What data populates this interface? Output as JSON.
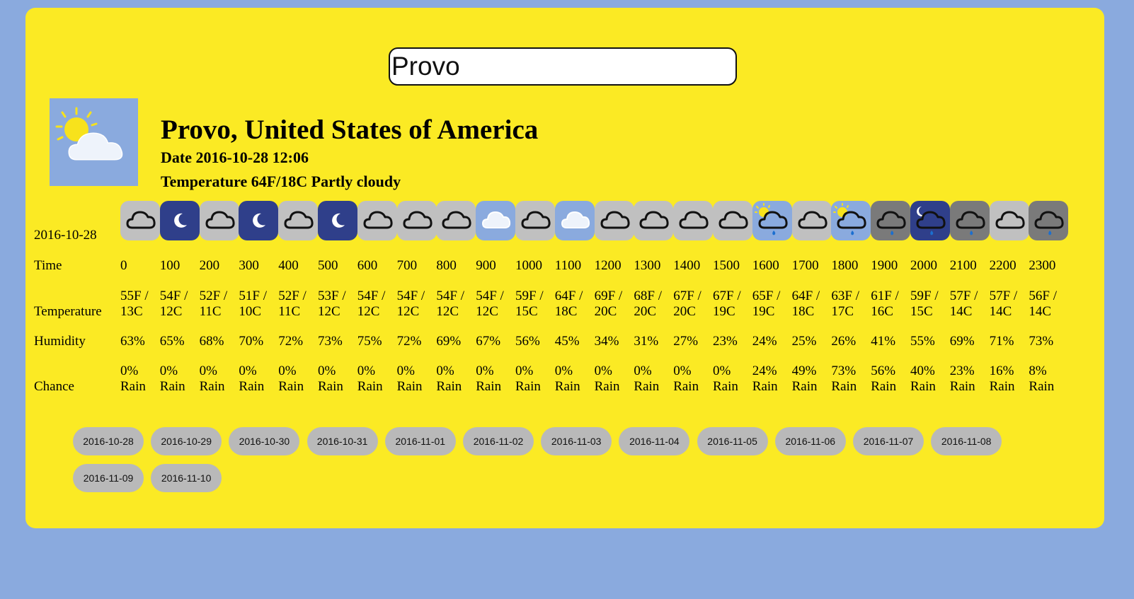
{
  "search": {
    "value": "Provo"
  },
  "current": {
    "location": "Provo, United States of America",
    "date": "Date 2016-10-28 12:06",
    "conditions": "Temperature 64F/18C Partly cloudy",
    "icon": "partly-cloudy-sun-icon"
  },
  "forecast": {
    "date": "2016-10-28",
    "labels": {
      "time": "Time",
      "temperature": "Temperature",
      "humidity": "Humidity",
      "chance": "Chance"
    },
    "hours": [
      {
        "time": "0",
        "temp_f": "55F /",
        "temp_c": "13C",
        "humidity": "63%",
        "rain_pct": "0%",
        "rain_word": "Rain",
        "icon": "cloud-outline-icon"
      },
      {
        "time": "100",
        "temp_f": "54F /",
        "temp_c": "12C",
        "humidity": "65%",
        "rain_pct": "0%",
        "rain_word": "Rain",
        "icon": "clear-night-moon-icon"
      },
      {
        "time": "200",
        "temp_f": "52F /",
        "temp_c": "11C",
        "humidity": "68%",
        "rain_pct": "0%",
        "rain_word": "Rain",
        "icon": "cloud-outline-icon"
      },
      {
        "time": "300",
        "temp_f": "51F /",
        "temp_c": "10C",
        "humidity": "70%",
        "rain_pct": "0%",
        "rain_word": "Rain",
        "icon": "clear-night-moon-icon"
      },
      {
        "time": "400",
        "temp_f": "52F /",
        "temp_c": "11C",
        "humidity": "72%",
        "rain_pct": "0%",
        "rain_word": "Rain",
        "icon": "cloud-outline-icon"
      },
      {
        "time": "500",
        "temp_f": "53F /",
        "temp_c": "12C",
        "humidity": "73%",
        "rain_pct": "0%",
        "rain_word": "Rain",
        "icon": "clear-night-moon-icon"
      },
      {
        "time": "600",
        "temp_f": "54F /",
        "temp_c": "12C",
        "humidity": "75%",
        "rain_pct": "0%",
        "rain_word": "Rain",
        "icon": "cloud-outline-icon"
      },
      {
        "time": "700",
        "temp_f": "54F /",
        "temp_c": "12C",
        "humidity": "72%",
        "rain_pct": "0%",
        "rain_word": "Rain",
        "icon": "cloud-outline-icon"
      },
      {
        "time": "800",
        "temp_f": "54F /",
        "temp_c": "12C",
        "humidity": "69%",
        "rain_pct": "0%",
        "rain_word": "Rain",
        "icon": "cloud-outline-icon"
      },
      {
        "time": "900",
        "temp_f": "54F /",
        "temp_c": "12C",
        "humidity": "67%",
        "rain_pct": "0%",
        "rain_word": "Rain",
        "icon": "white-cloud-icon"
      },
      {
        "time": "1000",
        "temp_f": "59F /",
        "temp_c": "15C",
        "humidity": "56%",
        "rain_pct": "0%",
        "rain_word": "Rain",
        "icon": "cloud-outline-icon"
      },
      {
        "time": "1100",
        "temp_f": "64F /",
        "temp_c": "18C",
        "humidity": "45%",
        "rain_pct": "0%",
        "rain_word": "Rain",
        "icon": "white-cloud-icon"
      },
      {
        "time": "1200",
        "temp_f": "69F /",
        "temp_c": "20C",
        "humidity": "34%",
        "rain_pct": "0%",
        "rain_word": "Rain",
        "icon": "cloud-outline-icon"
      },
      {
        "time": "1300",
        "temp_f": "68F /",
        "temp_c": "20C",
        "humidity": "31%",
        "rain_pct": "0%",
        "rain_word": "Rain",
        "icon": "cloud-outline-icon"
      },
      {
        "time": "1400",
        "temp_f": "67F /",
        "temp_c": "20C",
        "humidity": "27%",
        "rain_pct": "0%",
        "rain_word": "Rain",
        "icon": "cloud-outline-icon"
      },
      {
        "time": "1500",
        "temp_f": "67F /",
        "temp_c": "19C",
        "humidity": "23%",
        "rain_pct": "0%",
        "rain_word": "Rain",
        "icon": "cloud-outline-icon"
      },
      {
        "time": "1600",
        "temp_f": "65F /",
        "temp_c": "19C",
        "humidity": "24%",
        "rain_pct": "24%",
        "rain_word": "Rain",
        "icon": "sun-rain-cloud-icon"
      },
      {
        "time": "1700",
        "temp_f": "64F /",
        "temp_c": "18C",
        "humidity": "25%",
        "rain_pct": "49%",
        "rain_word": "Rain",
        "icon": "cloud-outline-icon"
      },
      {
        "time": "1800",
        "temp_f": "63F /",
        "temp_c": "17C",
        "humidity": "26%",
        "rain_pct": "73%",
        "rain_word": "Rain",
        "icon": "sun-rain-cloud-icon"
      },
      {
        "time": "1900",
        "temp_f": "61F /",
        "temp_c": "16C",
        "humidity": "41%",
        "rain_pct": "56%",
        "rain_word": "Rain",
        "icon": "rain-cloud-icon"
      },
      {
        "time": "2000",
        "temp_f": "59F /",
        "temp_c": "15C",
        "humidity": "55%",
        "rain_pct": "40%",
        "rain_word": "Rain",
        "icon": "moon-rain-cloud-icon"
      },
      {
        "time": "2100",
        "temp_f": "57F /",
        "temp_c": "14C",
        "humidity": "69%",
        "rain_pct": "23%",
        "rain_word": "Rain",
        "icon": "rain-cloud-icon"
      },
      {
        "time": "2200",
        "temp_f": "57F /",
        "temp_c": "14C",
        "humidity": "71%",
        "rain_pct": "16%",
        "rain_word": "Rain",
        "icon": "cloud-outline-icon"
      },
      {
        "time": "2300",
        "temp_f": "56F /",
        "temp_c": "14C",
        "humidity": "73%",
        "rain_pct": "8%",
        "rain_word": "Rain",
        "icon": "rain-cloud-icon"
      }
    ]
  },
  "date_buttons": [
    "2016-10-28",
    "2016-10-29",
    "2016-10-30",
    "2016-10-31",
    "2016-11-01",
    "2016-11-02",
    "2016-11-03",
    "2016-11-04",
    "2016-11-05",
    "2016-11-06",
    "2016-11-07",
    "2016-11-08",
    "2016-11-09",
    "2016-11-10"
  ],
  "colors": {
    "page_background": "#8aaade",
    "card_background": "#fbea24",
    "night_tile": "#2f3f8a",
    "day_tile": "#c0c0c0",
    "sky_tile": "#8aaade",
    "rain_tile": "#7a7a7a",
    "date_button": "#b9b9b9"
  }
}
